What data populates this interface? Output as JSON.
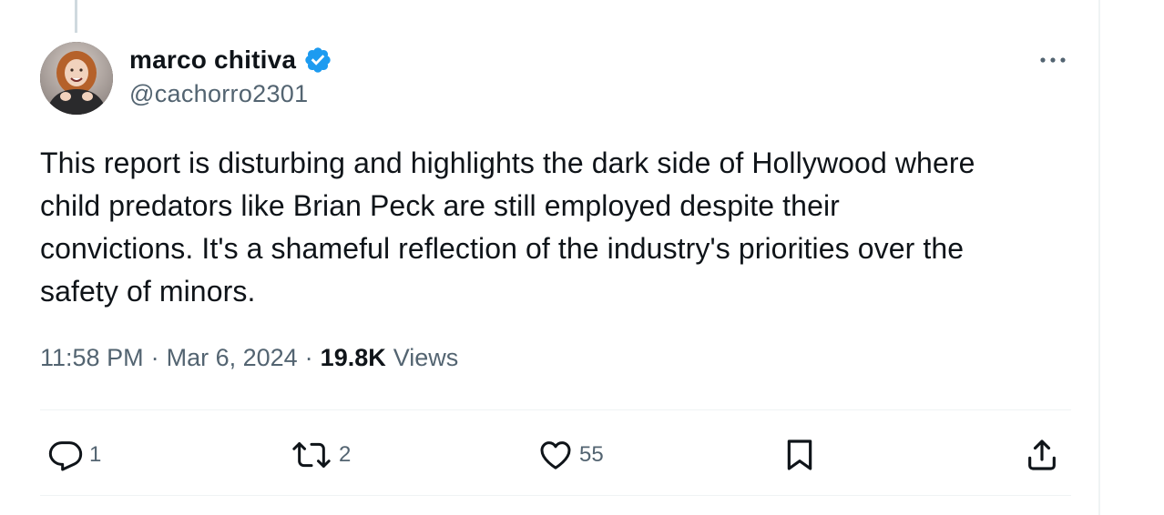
{
  "tweet": {
    "author": {
      "display_name": "marco chitiva",
      "handle": "@cachorro2301",
      "verified": true
    },
    "text": "This report is disturbing and highlights the dark side of Hollywood where\nchild predators like Brian Peck are still employed despite their\nconvictions. It's a shameful reflection of the industry's priorities over the\nsafety of minors.",
    "time": "11:58 PM",
    "date": "Mar 6, 2024",
    "separator": "·",
    "views_count": "19.8K",
    "views_label": "Views"
  },
  "actions": {
    "reply_count": "1",
    "retweet_count": "2",
    "like_count": "55"
  },
  "icons": {
    "more": "more-options-icon",
    "verified": "verified-badge-icon",
    "reply": "reply-icon",
    "retweet": "retweet-icon",
    "like": "heart-icon",
    "bookmark": "bookmark-icon",
    "share": "share-icon"
  },
  "colors": {
    "verified_blue": "#1d9bf0",
    "text_primary": "#0f1419",
    "text_secondary": "#536471",
    "divider": "#eff3f4"
  }
}
